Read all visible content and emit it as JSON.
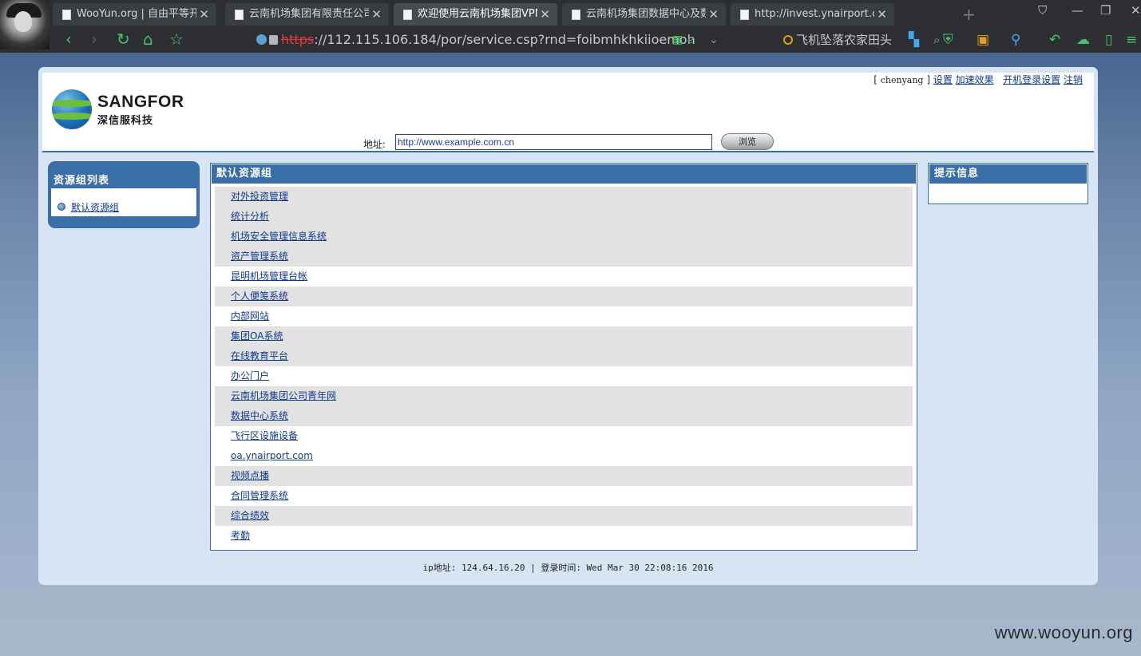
{
  "browser": {
    "tabs": [
      {
        "title": "WooYun.org | 自由平等开放",
        "active": false
      },
      {
        "title": "云南机场集团有限责任公司",
        "active": false
      },
      {
        "title": "欢迎使用云南机场集团VPN系统",
        "active": true
      },
      {
        "title": "云南机场集团数据中心及数据",
        "active": false
      },
      {
        "title": "http://invest.ynairport.com",
        "active": false
      }
    ],
    "address": {
      "scheme": "https",
      "rest": "://112.115.106.184/por/service.csp?rnd=foibmhkhkiioemoh"
    },
    "search_text": "飞机坠落农家田头",
    "accent_color": "#46c46a"
  },
  "header": {
    "logo_brand": "SANGFOR",
    "logo_brand_cn": "深信服科技",
    "user_bracket_open": "[",
    "username": "chenyang",
    "user_bracket_close": "]",
    "links": {
      "settings": "设置",
      "speedup": "加速效果",
      "startup_login": "开机登录设置",
      "logout": "注销"
    },
    "address_label": "地址:",
    "url_value": "http://www.example.com.cn",
    "browse_button": "浏览"
  },
  "sidebar": {
    "title": "资源组列表",
    "items": [
      "默认资源组"
    ]
  },
  "main": {
    "title": "默认资源组",
    "resources": [
      {
        "label": "对外投资管理",
        "shaded": true
      },
      {
        "label": "统计分析",
        "shaded": true
      },
      {
        "label": "机场安全管理信息系统",
        "shaded": true
      },
      {
        "label": "资产管理系统",
        "shaded": true
      },
      {
        "label": "昆明机场管理台帐",
        "shaded": false
      },
      {
        "label": "个人便笺系统",
        "shaded": true
      },
      {
        "label": "内部网站",
        "shaded": false
      },
      {
        "label": "集团OA系统",
        "shaded": true
      },
      {
        "label": "在线教育平台",
        "shaded": true
      },
      {
        "label": "办公门户",
        "shaded": false
      },
      {
        "label": "云南机场集团公司青年网",
        "shaded": true
      },
      {
        "label": "数据中心系统",
        "shaded": true
      },
      {
        "label": "飞行区设施设备",
        "shaded": false
      },
      {
        "label": "oa.ynairport.com",
        "shaded": false
      },
      {
        "label": "视频点播",
        "shaded": true
      },
      {
        "label": "合同管理系统",
        "shaded": false
      },
      {
        "label": "综合绩效",
        "shaded": true
      },
      {
        "label": "考勤",
        "shaded": false
      }
    ]
  },
  "info": {
    "title": "提示信息"
  },
  "footer": {
    "text": "ip地址: 124.64.16.20 | 登录时间: Wed Mar 30 22:08:16 2016"
  },
  "watermark": "www.wooyun.org",
  "colors": {
    "theme_blue": "#3a6ea6",
    "panel_bg": "#d6e4f4",
    "row_shade": "#e2e2e2",
    "link": "#103a8c"
  }
}
